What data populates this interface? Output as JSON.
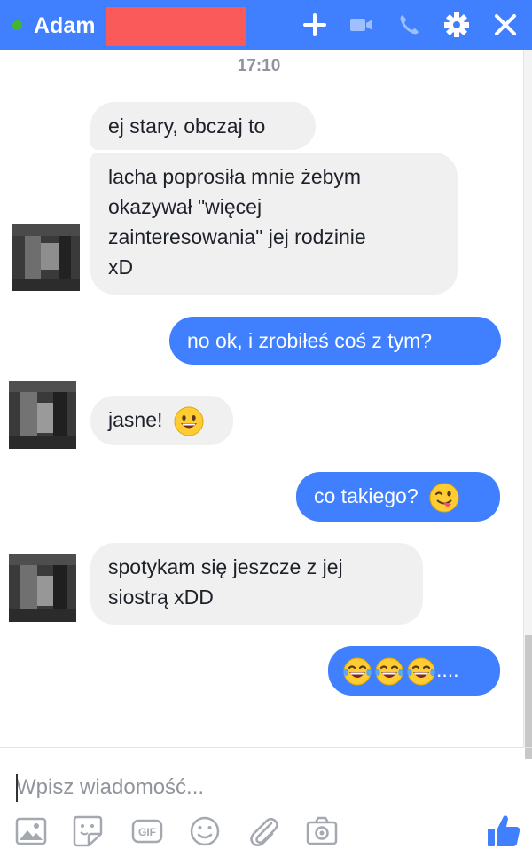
{
  "header": {
    "name": "Adam",
    "icons": [
      "plus-icon",
      "video-camera-icon",
      "phone-icon",
      "gear-icon",
      "close-icon"
    ]
  },
  "conversation": {
    "timestamp": "17:10",
    "messages": [
      {
        "direction": "in",
        "lines": [
          "ej stary, obczaj to"
        ]
      },
      {
        "direction": "in",
        "lines": [
          "lacha poprosiła mnie żebym",
          "okazywał \"więcej",
          "zainteresowania\" jej rodzinie",
          "xD"
        ]
      },
      {
        "direction": "out",
        "lines": [
          "no ok, i zrobiłeś coś z tym?"
        ]
      },
      {
        "direction": "in",
        "lines": [
          "jasne!"
        ],
        "emoji": "grinning-face-emoji"
      },
      {
        "direction": "out",
        "lines": [
          "co takiego?"
        ],
        "emoji": "winking-face-with-tongue-emoji"
      },
      {
        "direction": "in",
        "lines": [
          "spotykam się jeszcze z jej",
          "siostrą xDD"
        ]
      },
      {
        "direction": "out",
        "lines": [
          "...."
        ],
        "emoji": "tears-of-joy-emoji x3"
      }
    ]
  },
  "composer": {
    "placeholder": "Wpisz wiadomość...",
    "tools": [
      "photo-icon",
      "sticker-icon",
      "gif-icon",
      "emoji-icon",
      "attachment-icon",
      "camera-icon",
      "like-icon"
    ],
    "gif_label": "GIF"
  },
  "colors": {
    "accent": "#4080ff",
    "incoming_bubble": "#f1f0f0",
    "online": "#42b72a",
    "redaction": "#fa5a5a"
  }
}
